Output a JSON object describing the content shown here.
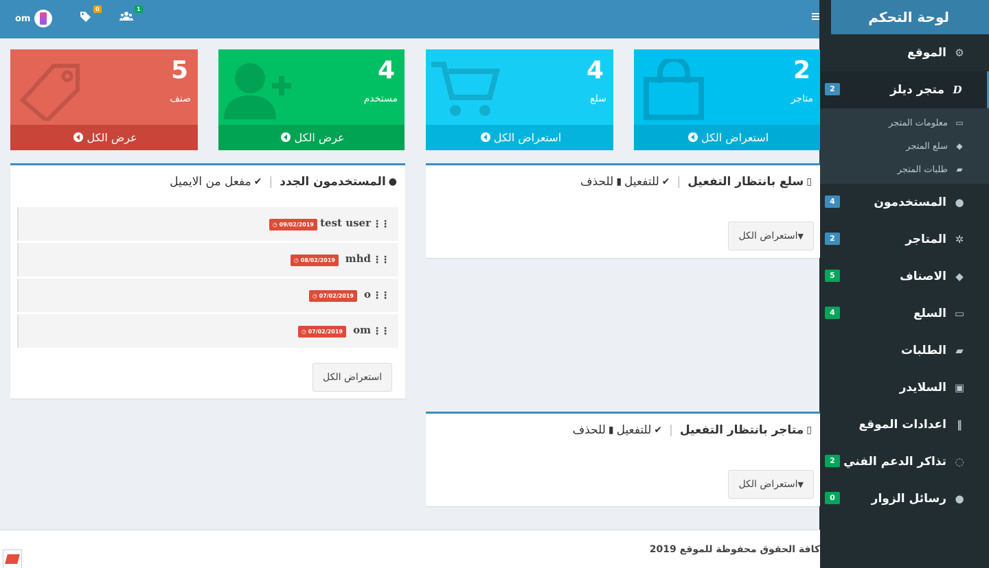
{
  "header": {
    "user_name": "om",
    "tags_count": "0",
    "users_count": "1"
  },
  "sidebar": {
    "title": "لوحة التحكم",
    "items": [
      {
        "label": "الموقع",
        "icon": "gear-icon",
        "badge": ""
      },
      {
        "label": "متجر ديلز",
        "icon": "d-logo-icon",
        "badge": "2"
      },
      {
        "label": "المستخدمون",
        "icon": "users-icon",
        "badge": "4"
      },
      {
        "label": "المتاجر",
        "icon": "cogs-icon",
        "badge": "2"
      },
      {
        "label": "الاصناف",
        "icon": "tags-icon",
        "badge": "5"
      },
      {
        "label": "السلع",
        "icon": "shopping-bag-icon",
        "badge": "4"
      },
      {
        "label": "الطلبات",
        "icon": "truck-icon",
        "badge": ""
      },
      {
        "label": "السلايدر",
        "icon": "image-icon",
        "badge": ""
      },
      {
        "label": "اعدادات الموقع",
        "icon": "barcode-icon",
        "badge": ""
      },
      {
        "label": "تذاكر الدعم الفني",
        "icon": "comment-icon",
        "badge": "2"
      },
      {
        "label": "رسائل الزوار",
        "icon": "comments-icon",
        "badge": "0"
      }
    ],
    "submenu": [
      {
        "label": "معلومات المتجر",
        "icon": "shopping-bag-icon"
      },
      {
        "label": "سلع المتجر",
        "icon": "tag-icon"
      },
      {
        "label": "طلبات المتجر",
        "icon": "truck-icon"
      }
    ]
  },
  "stats": [
    {
      "number": "2",
      "label": "متاجر",
      "footer": "استعراض الكل",
      "color": "#00c0ef"
    },
    {
      "number": "4",
      "label": "سلع",
      "footer": "استعراض الكل",
      "color": "#16cef5"
    },
    {
      "number": "4",
      "label": "مستخدم",
      "footer": "عرض الكل",
      "color": "#00c063"
    },
    {
      "number": "5",
      "label": "صنف",
      "footer": "عرض الكل",
      "color": "#e36555"
    }
  ],
  "pending_items": {
    "title": "سلع بانتظار التفعيل",
    "activate": "للتفعيل",
    "delete": "للحذف",
    "button": "استعراض الكل"
  },
  "pending_stores": {
    "title": "متاجر بانتظار التفعيل",
    "activate": "للتفعيل",
    "delete": "للحذف",
    "button": "استعراض الكل"
  },
  "new_users": {
    "title": "المستخدمون الجدد",
    "subtitle": "مفعل من الايميل",
    "button": "استعراض الكل",
    "rows": [
      {
        "name": "test user",
        "date": "09/02/2019"
      },
      {
        "name": "mhd",
        "date": "08/02/2019"
      },
      {
        "name": "o",
        "date": "07/02/2019"
      },
      {
        "name": "om",
        "date": "07/02/2019"
      }
    ]
  },
  "footer": {
    "copyright": "2019 كافة الحقوق محفوظة للموقع"
  }
}
